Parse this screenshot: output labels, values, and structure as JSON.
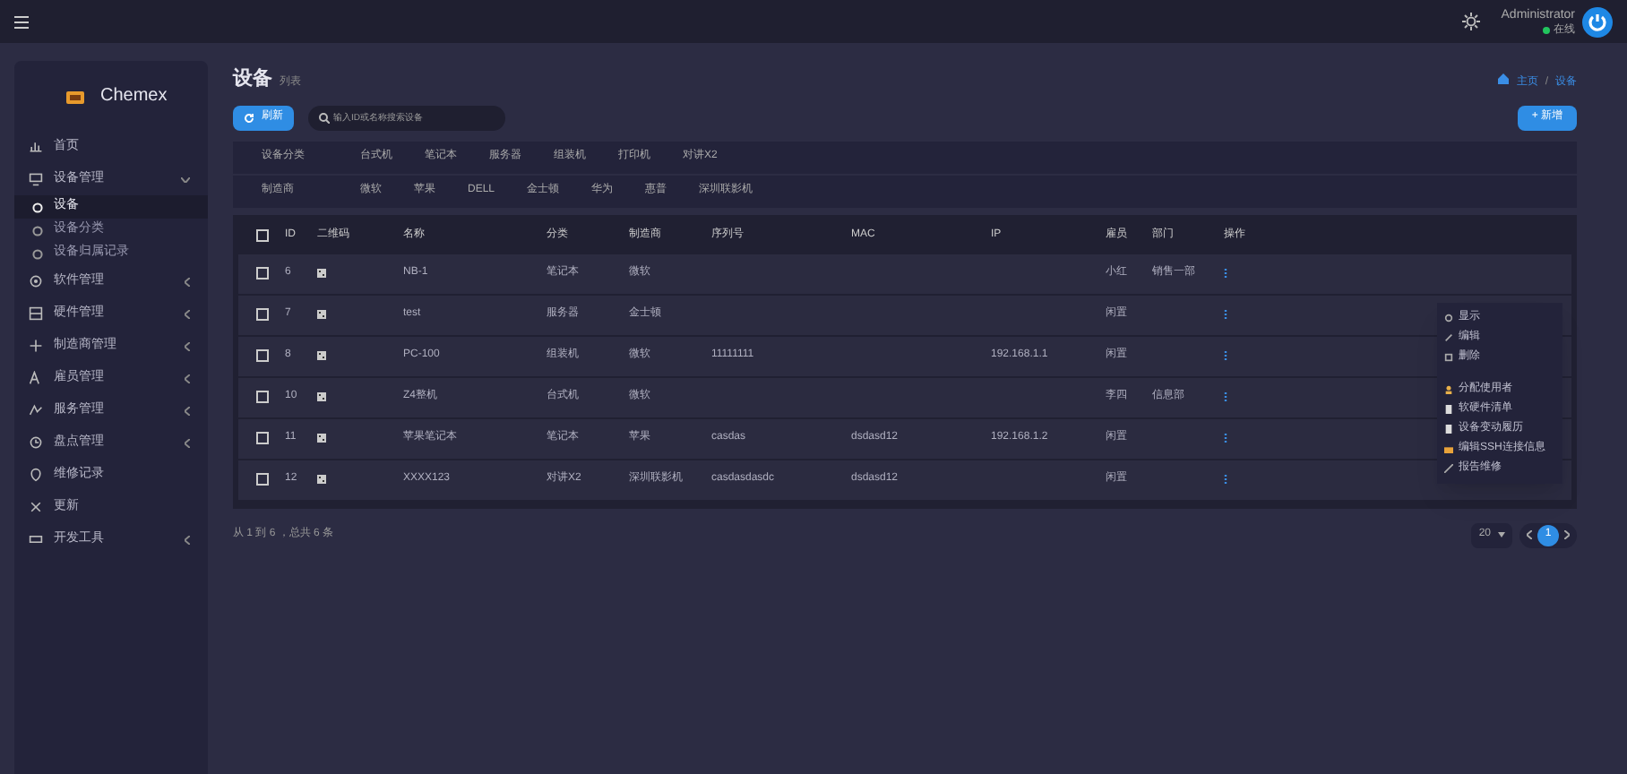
{
  "topbar": {
    "user": {
      "name": "Administrator",
      "status": "在线"
    }
  },
  "sidebar": {
    "brand": "Chemex",
    "items": [
      {
        "label": "首页",
        "kind": "link"
      },
      {
        "label": "设备管理",
        "kind": "group",
        "expanded": true,
        "children": [
          {
            "label": "设备",
            "selected": true
          },
          {
            "label": "设备分类",
            "selected": false
          },
          {
            "label": "设备归属记录",
            "selected": false
          }
        ]
      },
      {
        "label": "软件管理",
        "kind": "group",
        "expanded": false
      },
      {
        "label": "硬件管理",
        "kind": "group",
        "expanded": false
      },
      {
        "label": "制造商管理",
        "kind": "group",
        "expanded": false
      },
      {
        "label": "雇员管理",
        "kind": "group",
        "expanded": false
      },
      {
        "label": "服务管理",
        "kind": "group",
        "expanded": false
      },
      {
        "label": "盘点管理",
        "kind": "group",
        "expanded": false
      },
      {
        "label": "维修记录",
        "kind": "link"
      },
      {
        "label": "更新",
        "kind": "link"
      },
      {
        "label": "开发工具",
        "kind": "group",
        "expanded": false
      }
    ]
  },
  "page": {
    "title": "设备",
    "subtitle": "列表",
    "breadcrumb": [
      "主页",
      "设备"
    ],
    "breadcrumb_separator": "/",
    "new_button": "+ 新增",
    "refresh_button": "刷新",
    "search": {
      "placeholder": "输入ID或名称搜索设备"
    }
  },
  "filters": [
    {
      "label": "设备分类",
      "options": [
        "台式机",
        "笔记本",
        "服务器",
        "组装机",
        "打印机",
        "对讲X2"
      ]
    },
    {
      "label": "制造商",
      "options": [
        "微软",
        "苹果",
        "DELL",
        "金士顿",
        "华为",
        "惠普",
        "深圳联影机"
      ]
    }
  ],
  "table": {
    "select_all_checked": false,
    "columns": [
      "ID",
      "二维码",
      "名称",
      "分类",
      "制造商",
      "序列号",
      "MAC",
      "IP",
      "雇员",
      "部门",
      "操作"
    ],
    "rows": [
      {
        "checked": false,
        "cells": [
          "6",
          "",
          "NB-1",
          "笔记本",
          "微软",
          "",
          "",
          "",
          "小红",
          "销售一部"
        ]
      },
      {
        "checked": false,
        "cells": [
          "7",
          "",
          "test",
          "服务器",
          "金士顿",
          "",
          "",
          "",
          "闲置",
          ""
        ]
      },
      {
        "checked": false,
        "cells": [
          "8",
          "",
          "PC-100",
          "组装机",
          "微软",
          "11111111",
          "",
          "192.168.1.1",
          "闲置",
          ""
        ]
      },
      {
        "checked": false,
        "cells": [
          "10",
          "",
          "Z4整机",
          "台式机",
          "微软",
          "",
          "",
          "",
          "李四",
          "信息部"
        ]
      },
      {
        "checked": false,
        "cells": [
          "11",
          "",
          "苹果笔记本",
          "笔记本",
          "苹果",
          "casdas",
          "dsdasd12",
          "192.168.1.2",
          "闲置",
          ""
        ]
      },
      {
        "checked": false,
        "cells": [
          "12",
          "",
          "XXXX123",
          "对讲X2",
          "深圳联影机",
          "casdasdasdc",
          "dsdasd12",
          "",
          "闲置",
          ""
        ]
      }
    ]
  },
  "action_menu": {
    "sections": [
      [
        "显示",
        "编辑",
        "删除"
      ],
      [
        "分配使用者",
        "软硬件清单",
        "设备变动履历",
        "编辑SSH连接信息",
        "报告维修"
      ]
    ]
  },
  "footer": {
    "summary": "从 1 到 6 ，总共 6 条",
    "page_size": "20",
    "pages": [
      {
        "label": "1",
        "selected": true
      }
    ]
  }
}
